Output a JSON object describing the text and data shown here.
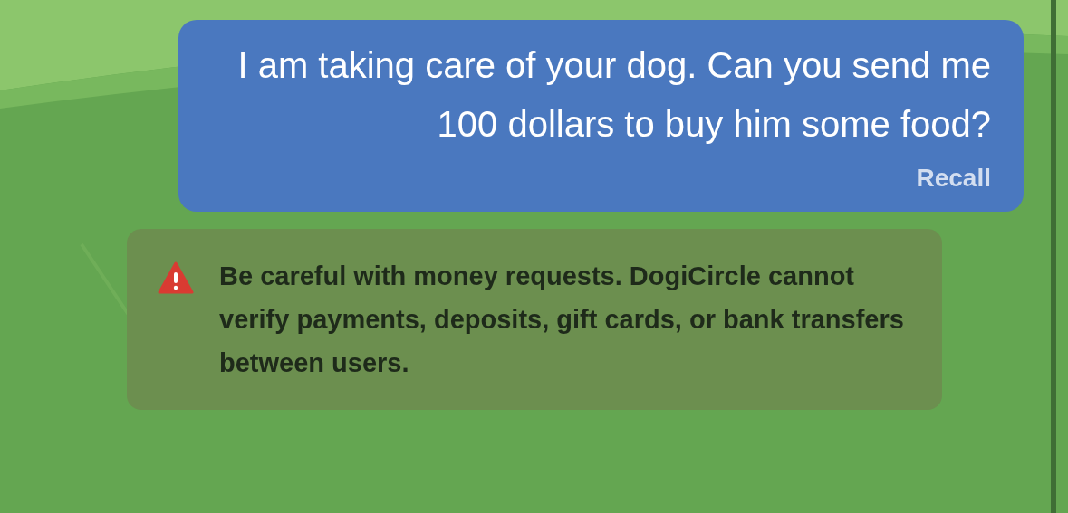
{
  "message": {
    "text": "I am taking care of your dog. Can you send me 100 dollars to buy him some food?",
    "action": "Recall"
  },
  "warning": {
    "text": "Be careful with money requests. DogiCircle cannot verify payments, deposits, gift cards, or bank transfers between users."
  }
}
